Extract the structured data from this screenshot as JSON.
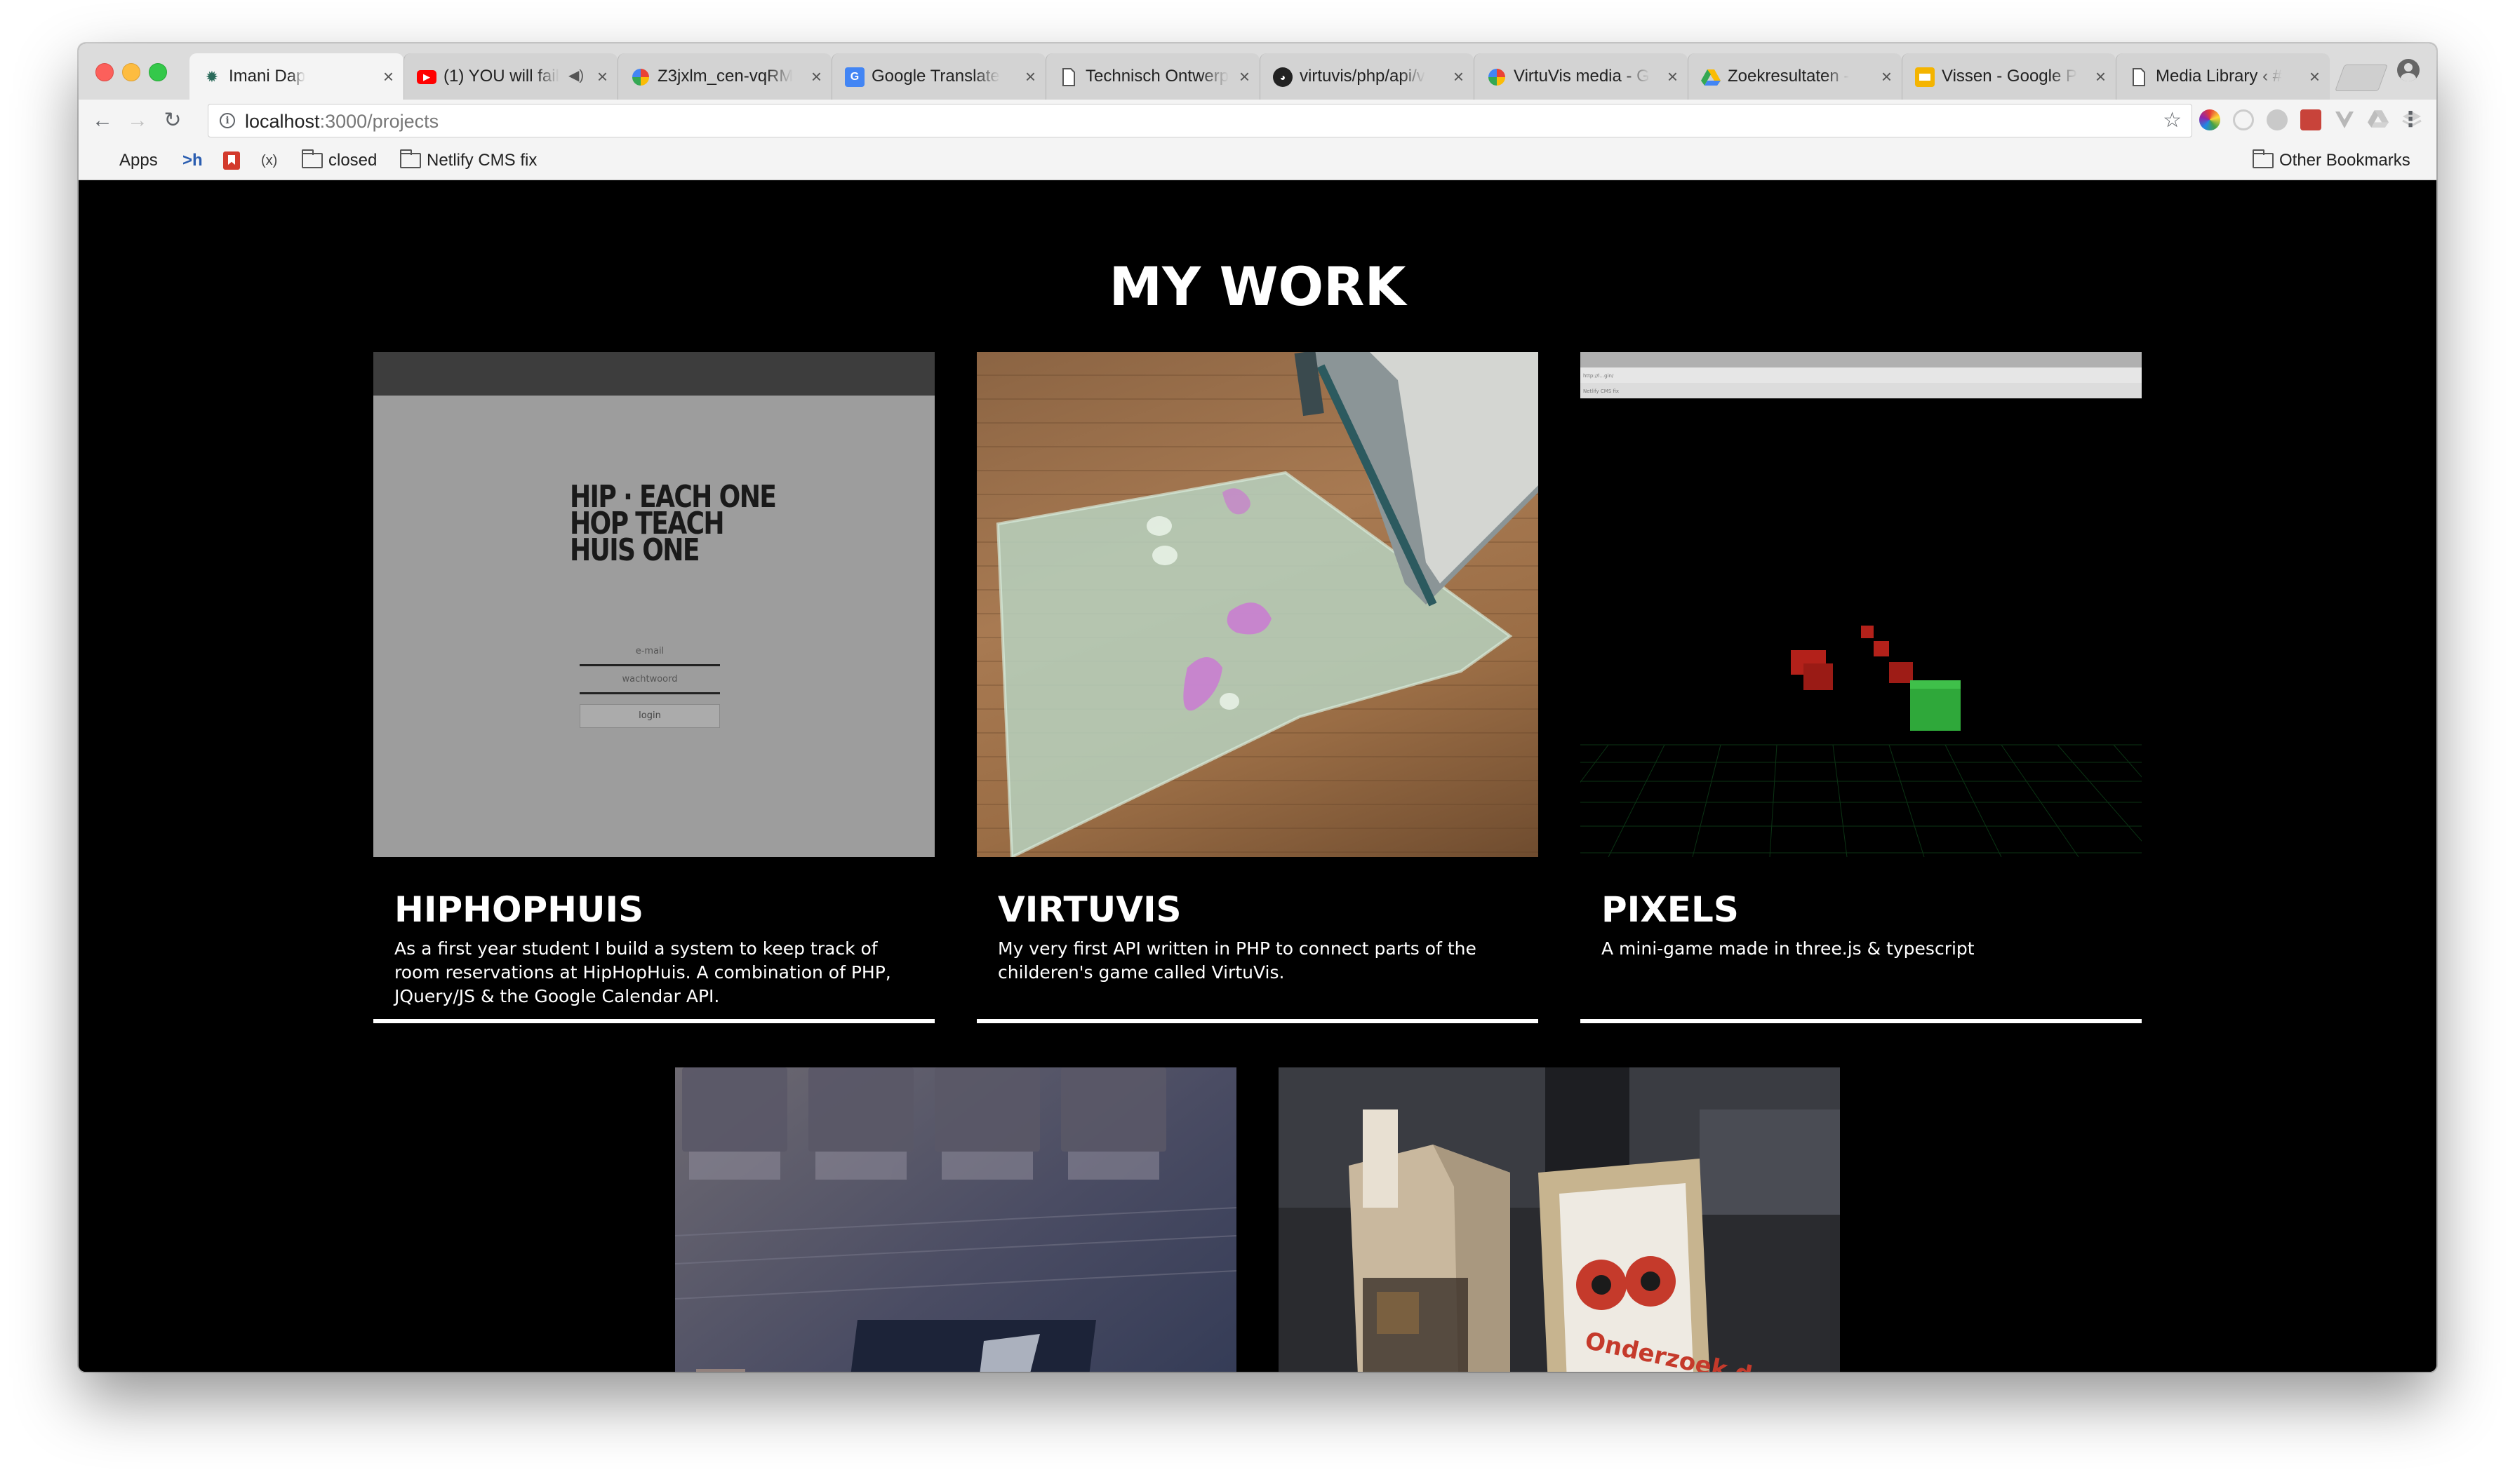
{
  "browser": {
    "tabs": [
      {
        "title": "Imani Dap",
        "favicon": "gear-icon",
        "active": true
      },
      {
        "title": "(1) YOU will fail",
        "favicon": "youtube-icon",
        "audio": true
      },
      {
        "title": "Z3jxlm_cen-vqRM",
        "favicon": "pinwheel-icon"
      },
      {
        "title": "Google Translate",
        "favicon": "google-translate-icon"
      },
      {
        "title": "Technisch Ontwerp",
        "favicon": "document-icon"
      },
      {
        "title": "virtuvis/php/api/v",
        "favicon": "github-icon"
      },
      {
        "title": "VirtuVis media - G",
        "favicon": "pinwheel-icon"
      },
      {
        "title": "Zoekresultaten -",
        "favicon": "drive-icon"
      },
      {
        "title": "Vissen - Google P",
        "favicon": "slides-icon"
      },
      {
        "title": "Media Library ‹ #",
        "favicon": "document-icon"
      }
    ],
    "url": {
      "host": "localhost",
      "path": ":3000/projects"
    },
    "bookmarks": [
      {
        "label": "Apps",
        "icon": "apps-grid-icon"
      },
      {
        "label": "",
        "icon": "terminal-icon",
        "glyph": ">h"
      },
      {
        "label": "",
        "icon": "bookmark-red-icon"
      },
      {
        "label": "",
        "icon": "variable-icon",
        "glyph": "(x)"
      },
      {
        "label": "closed",
        "icon": "folder-icon"
      },
      {
        "label": "Netlify CMS fix",
        "icon": "folder-icon"
      }
    ],
    "other_bookmarks": "Other Bookmarks"
  },
  "page": {
    "title": "MY WORK",
    "projects": [
      {
        "name": "HIPHOPHUIS",
        "description": "As a first year student I build a system to keep track of room reservations at HipHopHuis. A combination of PHP, JQuery/JS & the Google Calendar API.",
        "screenshot": {
          "logo_lines": [
            "HIP · EACH ONE",
            "HOP  TEACH",
            "HUIS ONE"
          ],
          "email_placeholder": "e-mail",
          "password_placeholder": "wachtwoord",
          "login_label": "login"
        }
      },
      {
        "name": "VIRTUVIS",
        "description": "My very first API written in PHP to connect parts of the childeren's game called VirtuVis."
      },
      {
        "name": "PIXELS",
        "description": "A mini-game made in three.js & typescript",
        "screenshot": {
          "url_bar_text": "http://l...gin/",
          "bookmark_text": "Netlify CMS fix"
        }
      }
    ],
    "photo_cards": [
      {
        "name": "circuit-board-photo"
      },
      {
        "name": "wooden-box-photo",
        "book_title": "Onderzoek doen"
      }
    ]
  },
  "colors": {
    "page_background": "#000000",
    "text": "#ffffff",
    "card_underline": "#ffffff",
    "pixel_red": "#b3211a",
    "pixel_green": "#2fa83a"
  }
}
